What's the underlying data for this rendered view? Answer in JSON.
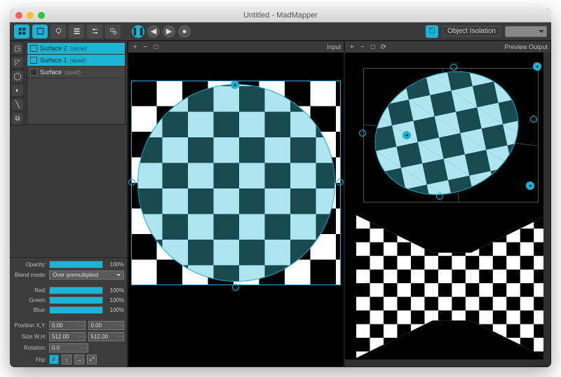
{
  "window": {
    "title": "Untitled - MadMapper"
  },
  "toolbar": {
    "mode_label": "Object Isolation",
    "icons": [
      "grid-icon",
      "quad-icon",
      "lamp-icon",
      "list-icon",
      "sliders-icon",
      "gears-icon"
    ],
    "transport": [
      "pause-icon",
      "step-back-icon",
      "step-forward-icon",
      "record-icon"
    ],
    "right_toggle": "link-icon"
  },
  "surfaces": [
    {
      "name": "Surface 2",
      "type": "(circle)",
      "selected": true
    },
    {
      "name": "Surface 1",
      "type": "(quad)",
      "selected": true
    },
    {
      "name": "Surface",
      "type": "(quad)",
      "selected": false
    }
  ],
  "vtool_icons": [
    "add-quad",
    "add-triangle",
    "add-circle",
    "add-mask",
    "add-line",
    "duplicate"
  ],
  "panes": {
    "left_title": "Input",
    "right_title": "Preview Output",
    "pane_btn_labels": [
      "+",
      "−",
      "□",
      "⟳"
    ]
  },
  "props": {
    "opacity_label": "Opacity:",
    "opacity_pct": "100%",
    "blend_label": "Blend mode:",
    "blend_value": "Over premultiplied",
    "red_label": "Red:",
    "red_pct": "100%",
    "green_label": "Green:",
    "green_pct": "100%",
    "blue_label": "Blue:",
    "blue_pct": "100%",
    "pos_label": "Position X,Y:",
    "pos_x": "0.00",
    "pos_y": "0.00",
    "size_label": "Size W,H:",
    "size_w": "512.00",
    "size_h": "512.00",
    "rot_label": "Rotation:",
    "rot": "0.0",
    "flip_label": "Flip:",
    "flip": [
      "F",
      "↕",
      "↔",
      "⤢"
    ]
  },
  "colors": {
    "accent": "#1bb4d4",
    "teal_dark": "#184a52",
    "teal_light": "#aee5ee"
  }
}
